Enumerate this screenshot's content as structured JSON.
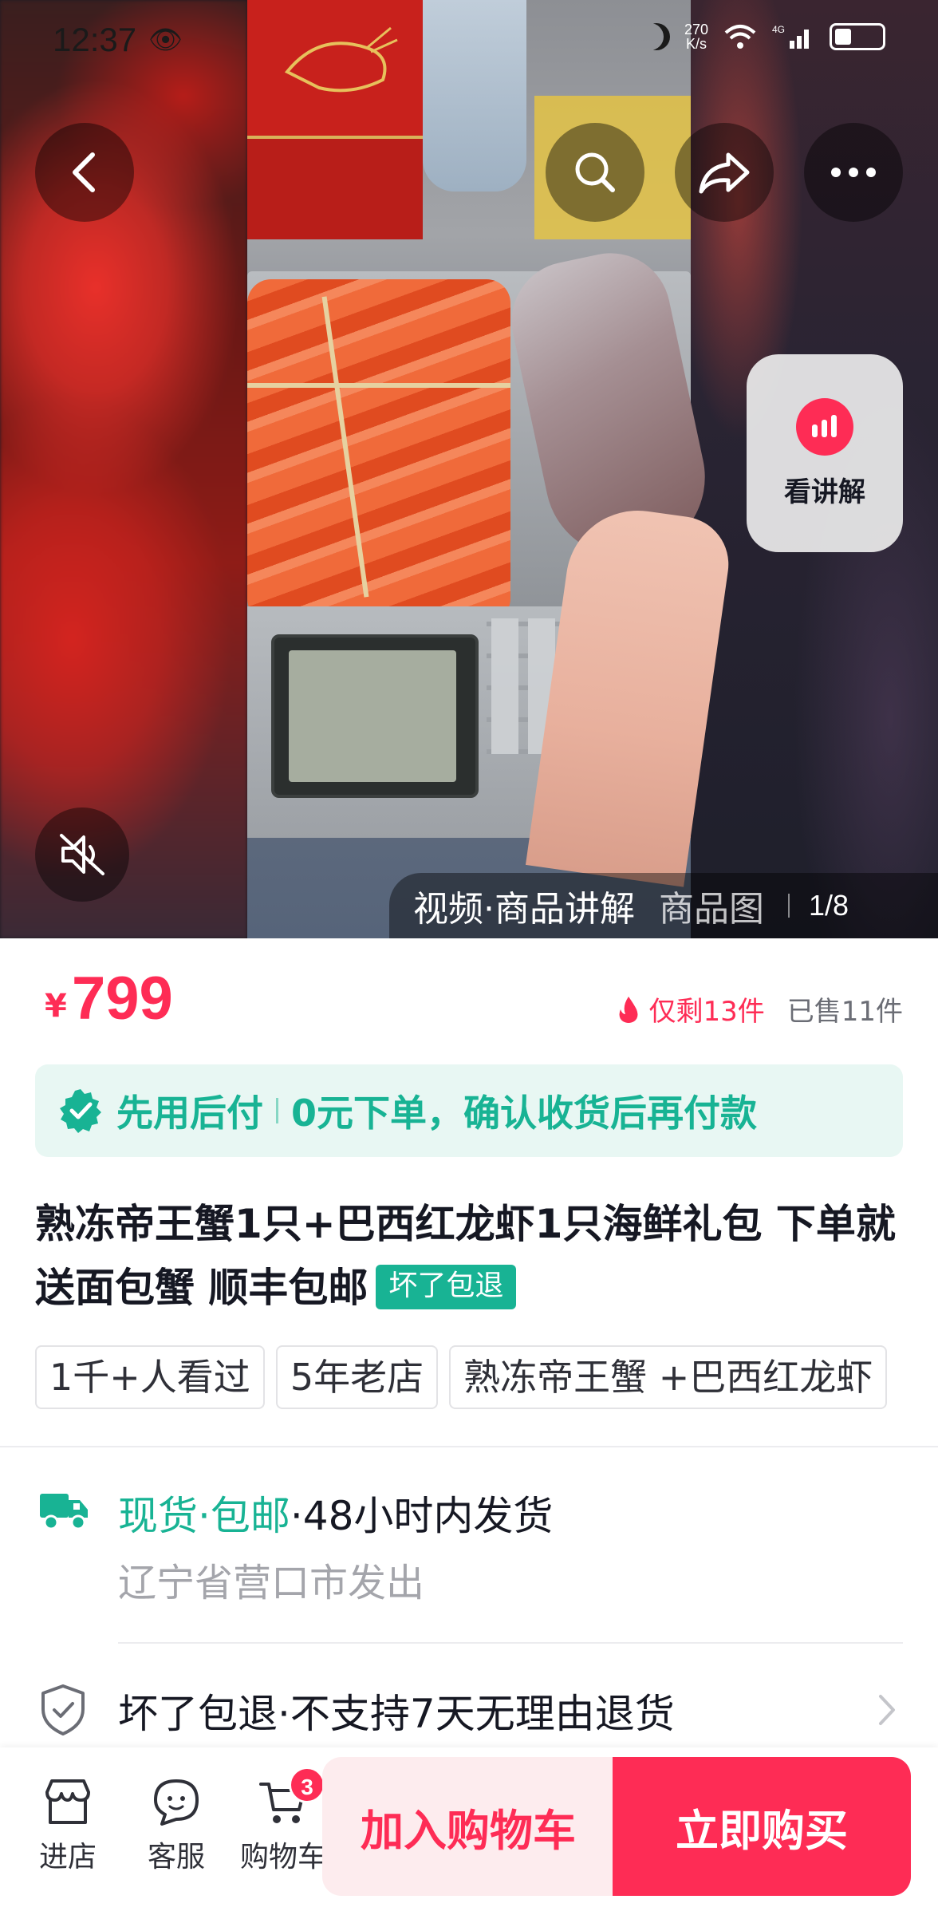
{
  "status_bar": {
    "time": "12:37",
    "net_speed_value": "270",
    "net_speed_unit": "K/s",
    "network": "4G"
  },
  "media": {
    "explain_label": "看讲解",
    "tabs": [
      {
        "label": "视频·商品讲解",
        "active": true
      },
      {
        "label": "商品图",
        "active": false
      }
    ],
    "counter": "1/8"
  },
  "price": {
    "symbol": "¥",
    "value": "799",
    "stock_left": "仅剩13件",
    "sold": "已售11件"
  },
  "pay_later": {
    "title": "先用后付",
    "desc": "0元下单，确认收货后再付款"
  },
  "product": {
    "title": "熟冻帝王蟹1只+巴西红龙虾1只海鲜礼包 下单就送面包蟹 顺丰包邮",
    "badge": "坏了包退"
  },
  "chips": [
    "1千+人看过",
    "5年老店",
    "熟冻帝王蟹 +巴西红龙虾"
  ],
  "shipping": {
    "tag": "现货·包邮",
    "time": "·48小时内发货",
    "origin": "辽宁省营口市发出"
  },
  "guarantee": {
    "text": "坏了包退·不支持7天无理由退货"
  },
  "bottom_bar": {
    "store_label": "进店",
    "service_label": "客服",
    "cart_label": "购物车",
    "cart_count": "3",
    "add_cart_label": "加入购物车",
    "buy_label": "立即购买"
  },
  "colors": {
    "accent_red": "#fe2c55",
    "accent_green": "#18b394",
    "pay_later_bg": "#e8f7f3"
  },
  "icons": [
    "back-arrow-icon",
    "search-icon",
    "share-icon",
    "more-icon",
    "mute-icon",
    "bars-icon",
    "flame-icon",
    "check-shield-icon",
    "truck-icon",
    "shield-icon",
    "chevron-right-icon",
    "store-icon",
    "chat-icon",
    "cart-icon"
  ]
}
